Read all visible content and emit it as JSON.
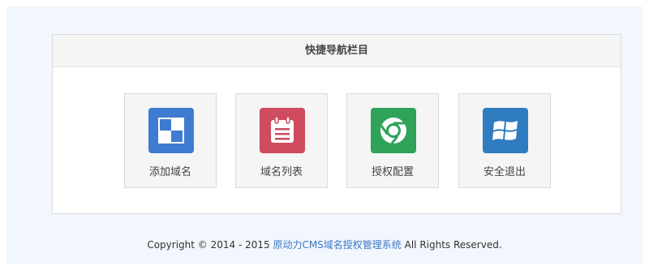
{
  "panel": {
    "title": "快捷导航栏目"
  },
  "nav": [
    {
      "label": "添加域名",
      "icon": "grid-icon",
      "color": "#3f7bd0"
    },
    {
      "label": "域名列表",
      "icon": "notepad-icon",
      "color": "#cf4b5e"
    },
    {
      "label": "授权配置",
      "icon": "chrome-icon",
      "color": "#2ea359"
    },
    {
      "label": "安全退出",
      "icon": "windows-icon",
      "color": "#2f7cc0"
    }
  ],
  "footer": {
    "prefix": "Copyright © 2014 - 2015 ",
    "link_text": "原动力CMS域名授权管理系统",
    "suffix": " All Rights Reserved."
  }
}
